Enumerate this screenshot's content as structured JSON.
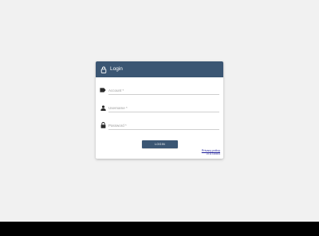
{
  "login": {
    "title": "Login",
    "fields": {
      "account": {
        "placeholder": "Account *",
        "value": ""
      },
      "username": {
        "placeholder": "Username *",
        "value": ""
      },
      "password": {
        "placeholder": "Password *",
        "value": ""
      }
    },
    "button_label": "LOGIN",
    "footer_link": "Privacy policy",
    "version": "V2.11.0-R0019"
  },
  "icons": {
    "header": "lock-icon",
    "account": "tag-icon",
    "username": "person-icon",
    "password": "lock-icon"
  },
  "colors": {
    "primary": "#3b5673",
    "background": "#f1f1f1",
    "card": "#ffffff"
  }
}
